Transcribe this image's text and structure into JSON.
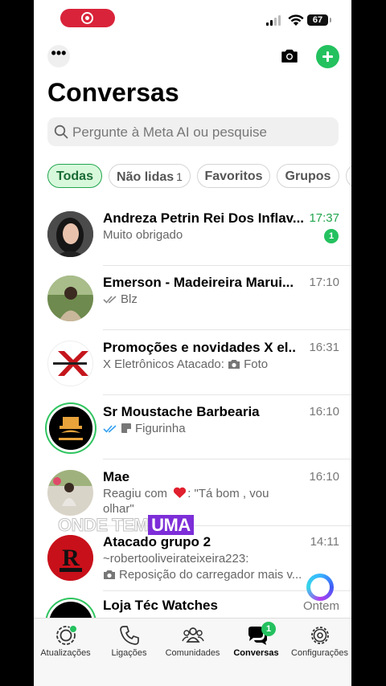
{
  "status_bar": {
    "battery": "67",
    "recording_icon": "record-icon"
  },
  "header": {
    "title": "Conversas",
    "more_icon": "ellipsis-icon",
    "more_label": "•••",
    "camera_icon": "camera-icon",
    "new_chat_icon": "plus-icon"
  },
  "search": {
    "placeholder": "Pergunte à Meta AI ou pesquise"
  },
  "filters": [
    {
      "label": "Todas",
      "count": "",
      "active": true
    },
    {
      "label": "Não lidas",
      "count": "1",
      "active": false
    },
    {
      "label": "Favoritos",
      "count": "",
      "active": false
    },
    {
      "label": "Grupos",
      "count": "",
      "active": false
    }
  ],
  "chats": [
    {
      "name": "Andreza Petrin Rei Dos Inflav...",
      "time": "17:37",
      "message": "Muito obrigado",
      "unread": "1"
    },
    {
      "name": "Emerson - Madeireira Marui...",
      "time": "17:10",
      "message": "Blz"
    },
    {
      "name": "Promoções e novidades X el...",
      "time": "16:31",
      "message": "X Eletrônicos Atacado:",
      "media_label": "Foto"
    },
    {
      "name": "Sr Moustache Barbearia",
      "time": "16:10",
      "message": "Figurinha"
    },
    {
      "name": "Mae",
      "time": "16:10",
      "message_prefix": "Reagiu com",
      "message": ": \"Tá bom , vou",
      "message_line2": "olhar\""
    },
    {
      "name": "Atacado grupo 2",
      "time": "14:11",
      "message": "~robertooliveirateixeira223:",
      "message_line2": "Reposição do carregador mais v..."
    },
    {
      "name": "Loja Téc Watches",
      "time": "Ontem",
      "message": ""
    }
  ],
  "caption": {
    "word1": "ONDE TEM",
    "word2": "UMA"
  },
  "tabbar": [
    {
      "label": "Atualizações",
      "icon": "status-icon"
    },
    {
      "label": "Ligações",
      "icon": "phone-icon"
    },
    {
      "label": "Comunidades",
      "icon": "people-icon"
    },
    {
      "label": "Conversas",
      "icon": "chat-bubbles-icon",
      "badge": "1"
    },
    {
      "label": "Configurações",
      "icon": "gear-icon"
    }
  ],
  "colors": {
    "accent": "#24c15f",
    "chip_active_bg": "#d8f8dc",
    "recording": "#d9233a"
  }
}
